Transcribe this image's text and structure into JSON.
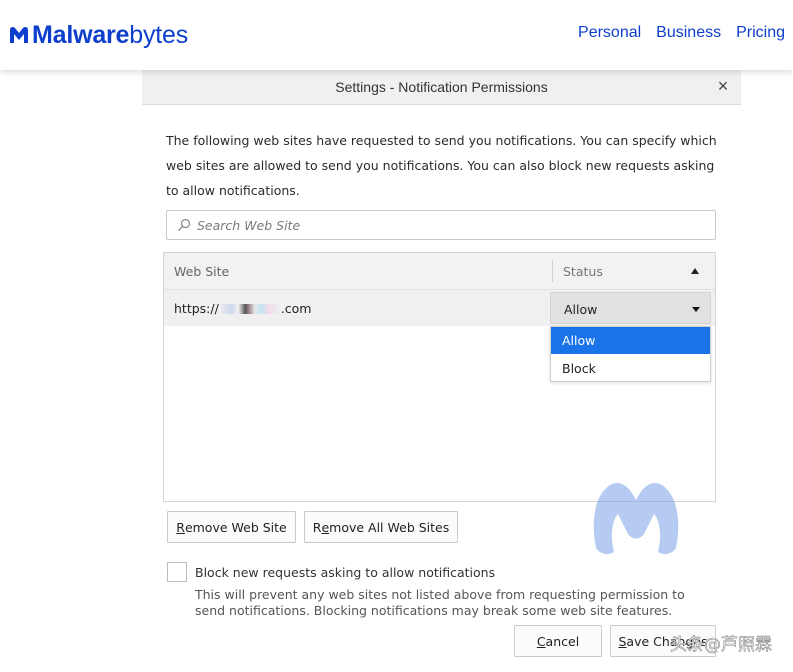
{
  "header": {
    "logo_bold": "Malware",
    "logo_light": "bytes",
    "nav": [
      "Personal",
      "Business",
      "Pricing"
    ]
  },
  "dialog": {
    "title": "Settings - Notification Permissions",
    "close_glyph": "×",
    "description": "The following web sites have requested to send you notifications. You can specify which web sites are allowed to send you notifications. You can also block new requests asking to allow notifications.",
    "search": {
      "placeholder": "Search Web Site"
    },
    "table": {
      "col_site": "Web Site",
      "col_status": "Status",
      "rows": [
        {
          "site_prefix": "https://",
          "site_suffix": ".com",
          "status": "Allow"
        }
      ]
    },
    "dropdown": {
      "options": [
        "Allow",
        "Block"
      ],
      "selected": "Allow"
    },
    "buttons": {
      "remove_pre": "",
      "remove_key": "R",
      "remove_post": "emove Web Site",
      "remove_all_pre": "R",
      "remove_all_key": "e",
      "remove_all_post": "move All Web Sites",
      "cancel_key": "C",
      "cancel_post": "ancel",
      "save_key": "S",
      "save_post": "ave Changes"
    },
    "block_checkbox": {
      "label": "Block new requests asking to allow notifications",
      "checked": false,
      "help": "This will prevent any web sites not listed above from requesting permission to send notifications. Blocking notifications may break some web site features."
    }
  },
  "watermark": {
    "text": "头条@芦照霖"
  },
  "colors": {
    "brand": "#0d3ecc",
    "selection": "#1a73e8"
  }
}
